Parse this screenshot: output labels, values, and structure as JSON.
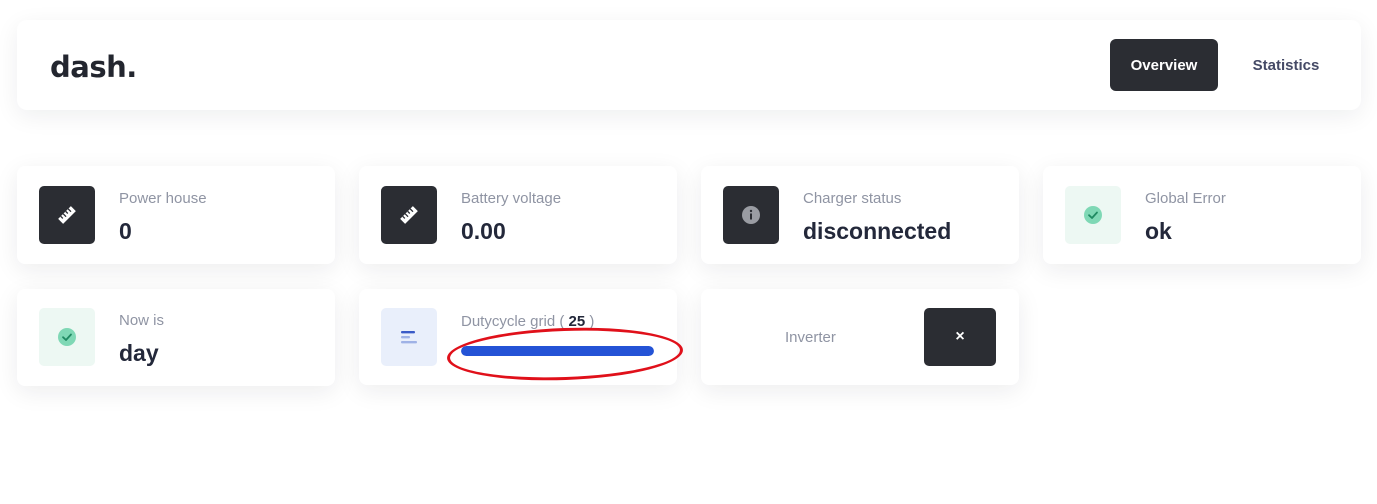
{
  "header": {
    "logo": "dash.",
    "nav": {
      "overview": "Overview",
      "statistics": "Statistics"
    }
  },
  "cards": {
    "power_house": {
      "label": "Power house",
      "value": "0",
      "icon": "ruler-icon"
    },
    "battery_voltage": {
      "label": "Battery voltage",
      "value": "0.00",
      "icon": "ruler-icon"
    },
    "charger_status": {
      "label": "Charger status",
      "value": "disconnected",
      "icon": "info-icon"
    },
    "global_error": {
      "label": "Global Error",
      "value": "ok",
      "icon": "check-circle-icon"
    },
    "now_is": {
      "label": "Now is",
      "value": "day",
      "icon": "check-circle-icon"
    },
    "dutycycle_grid": {
      "label": "Dutycycle grid",
      "paren_open": "(",
      "count": "25",
      "paren_close": ")",
      "icon": "align-left-icon",
      "bar_fill_fraction": 1.0
    },
    "inverter": {
      "label": "Inverter",
      "button_symbol": "×",
      "icon": "close-icon"
    }
  },
  "colors": {
    "dark": "#2b2d33",
    "green_bg": "#edf8f3",
    "green_check": "#34c38f",
    "blue_bar": "#2453d6",
    "annotation": "#e0101a"
  }
}
